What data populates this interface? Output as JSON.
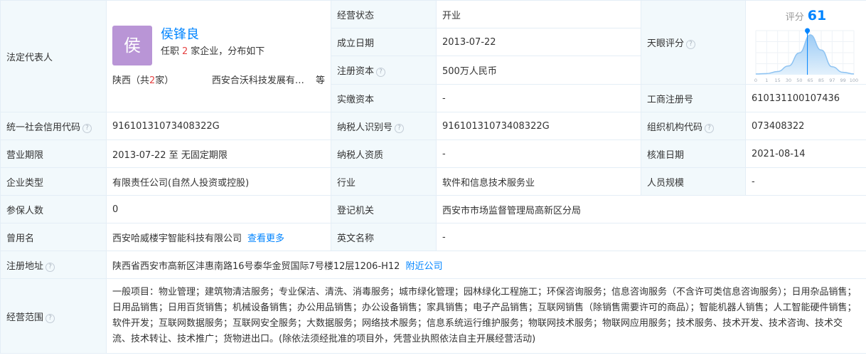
{
  "legal_rep": {
    "label": "法定代表人",
    "avatar_char": "侯",
    "name": "侯锋良",
    "sub_prefix": "任职",
    "sub_count": "2",
    "sub_suffix": "家企业，分布如下",
    "region": "陕西（共",
    "region_count": "2",
    "region_suffix": "家）",
    "company": "西安合沃科技发展有限公司",
    "etc": "等"
  },
  "rows": {
    "status": {
      "label": "经营状态",
      "value": "开业"
    },
    "established": {
      "label": "成立日期",
      "value": "2013-07-22"
    },
    "reg_capital": {
      "label": "注册资本",
      "value": "500万人民币"
    },
    "paid_capital": {
      "label": "实缴资本",
      "value": "-"
    },
    "tianyan": {
      "label": "天眼评分"
    },
    "reg_no": {
      "label": "工商注册号",
      "value": "610131100107436"
    },
    "credit_code": {
      "label": "统一社会信用代码",
      "value": "91610131073408322G"
    },
    "taxpayer_id": {
      "label": "纳税人识别号",
      "value": "91610131073408322G"
    },
    "org_code": {
      "label": "组织机构代码",
      "value": "073408322"
    },
    "term": {
      "label": "营业期限",
      "value": "2013-07-22  至  无固定期限"
    },
    "taxpayer_qual": {
      "label": "纳税人资质",
      "value": "-"
    },
    "approved": {
      "label": "核准日期",
      "value": "2021-08-14"
    },
    "type": {
      "label": "企业类型",
      "value": "有限责任公司(自然人投资或控股)"
    },
    "industry": {
      "label": "行业",
      "value": "软件和信息技术服务业"
    },
    "staff": {
      "label": "人员规模",
      "value": "-"
    },
    "insured": {
      "label": "参保人数",
      "value": "0"
    },
    "authority": {
      "label": "登记机关",
      "value": "西安市市场监督管理局高新区分局"
    },
    "former": {
      "label": "曾用名",
      "value": "西安哈威楼宇智能科技有限公司",
      "link": "查看更多"
    },
    "english": {
      "label": "英文名称",
      "value": "-"
    },
    "address": {
      "label": "注册地址",
      "value": "陕西省西安市高新区沣惠南路16号泰华金贸国际7号楼12层1206-H12",
      "link": "附近公司"
    },
    "scope": {
      "label": "经营范围",
      "value": "一般项目：物业管理；建筑物清洁服务；专业保洁、清洗、消毒服务；城市绿化管理；园林绿化工程施工；环保咨询服务；信息咨询服务（不含许可类信息咨询服务）；日用杂品销售；日用品销售；日用百货销售；机械设备销售；办公用品销售；办公设备销售；家具销售；电子产品销售；互联网销售（除销售需要许可的商品）；智能机器人销售；人工智能硬件销售；软件开发；互联网数据服务；互联网安全服务；大数据服务；网络技术服务；信息系统运行维护服务；物联网技术服务；物联网应用服务；技术服务、技术开发、技术咨询、技术交流、技术转让、技术推广；货物进出口。(除依法须经批准的项目外，凭营业执照依法自主开展经营活动)"
    }
  },
  "help_icon": "?",
  "chart_data": {
    "type": "area",
    "title": "评分",
    "score": "61",
    "score_value": 61,
    "x_ticks": [
      "0",
      "1",
      "15",
      "30",
      "50",
      "65",
      "85",
      "97",
      "99",
      "100"
    ],
    "curve_y": [
      0.02,
      0.03,
      0.08,
      0.22,
      0.55,
      1.0,
      0.62,
      0.2,
      0.06,
      0.02
    ],
    "colors": {
      "fill_top": "#9ccbf5",
      "fill_bottom": "#e3f1fc",
      "line": "#8ec3f2",
      "marker": "#0084ff"
    },
    "grid": true
  }
}
